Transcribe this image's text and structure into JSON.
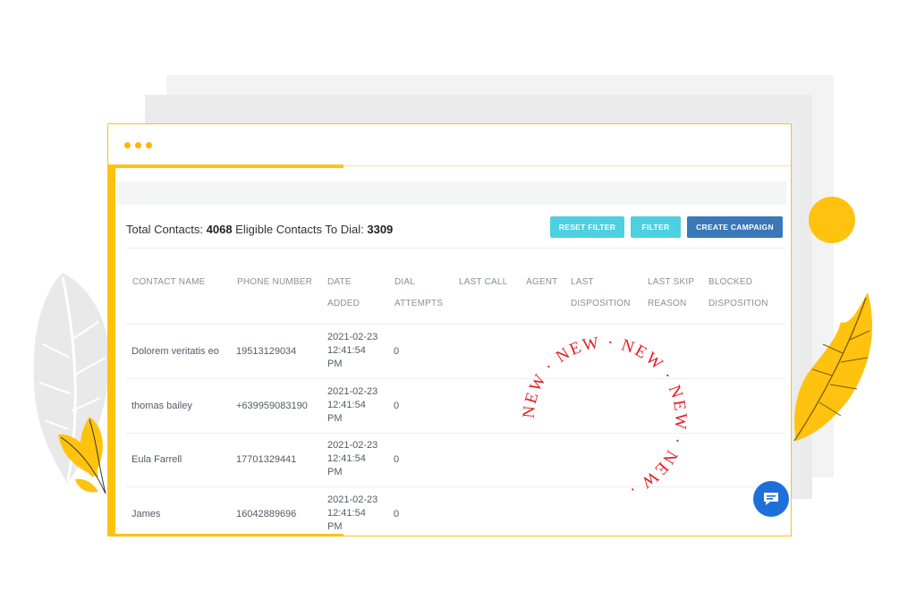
{
  "summary": {
    "total_label": "Total Contacts:",
    "total_value": "4068",
    "eligible_label": "Eligible Contacts To Dial:",
    "eligible_value": "3309"
  },
  "buttons": {
    "reset_filter": "RESET FILTER",
    "filter": "FILTER",
    "create_campaign": "CREATE CAMPAIGN"
  },
  "columns": [
    {
      "line1": "",
      "line2": "CONTACT NAME"
    },
    {
      "line1": "",
      "line2": "PHONE NUMBER"
    },
    {
      "line1": "DATE",
      "line2": "ADDED"
    },
    {
      "line1": "DIAL",
      "line2": "ATTEMPTS"
    },
    {
      "line1": "",
      "line2": "LAST CALL"
    },
    {
      "line1": "",
      "line2": "AGENT"
    },
    {
      "line1": "LAST",
      "line2": "DISPOSITION"
    },
    {
      "line1": "LAST SKIP",
      "line2": "REASON"
    },
    {
      "line1": "BLOCKED",
      "line2": "DISPOSITION"
    }
  ],
  "rows": [
    {
      "name": "Dolorem veritatis eo",
      "phone": "19513129034",
      "date": "2021-02-23",
      "time1": "12:41:54",
      "time2": "PM",
      "attempts": "0"
    },
    {
      "name": "thomas bailey",
      "phone": "+639959083190",
      "date": "2021-02-23",
      "time1": "12:41:54",
      "time2": "PM",
      "attempts": "0"
    },
    {
      "name": "Eula Farrell",
      "phone": "17701329441",
      "date": "2021-02-23",
      "time1": "12:41:54",
      "time2": "PM",
      "attempts": "0"
    },
    {
      "name": "James",
      "phone": "16042889696",
      "date": "2021-02-23",
      "time1": "12:41:54",
      "time2": "PM",
      "attempts": "0"
    }
  ],
  "stamp": {
    "text": "NEW · NEW · NEW · NEW · NEW · ",
    "color": "#e31e24"
  },
  "colors": {
    "accent_yellow": "#ffc20e",
    "cyan_button": "#4dd0e1",
    "blue_button": "#3a78b8",
    "chat_blue": "#1e6fd9"
  },
  "icons": {
    "chat": "chat-bubble-icon",
    "window_dots": "window-dots-icon"
  }
}
